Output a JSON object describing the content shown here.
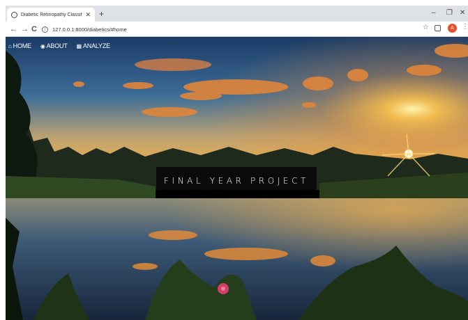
{
  "browser": {
    "tab_title": "Diabetic Retinopathy Classifier",
    "tab_close": "✕",
    "new_tab": "+",
    "url": "127.0.0.1:8000/diabetics/#home",
    "back": "←",
    "forward": "→",
    "reload": "C",
    "bookmark_icon": "☆",
    "profile_initial": "A",
    "menu": "⋮",
    "minimize": "–",
    "restore": "❐",
    "close": "✕"
  },
  "nav": {
    "items": [
      {
        "icon": "home-icon",
        "glyph": "⌂",
        "label": "HOME"
      },
      {
        "icon": "eye-icon",
        "glyph": "◉",
        "label": "ABOUT"
      },
      {
        "icon": "table-icon",
        "glyph": "▦",
        "label": "ANALYZE"
      }
    ]
  },
  "hero": {
    "banner_text": "FINAL YEAR PROJECT",
    "image": "sunset-lake-photo"
  },
  "colors": {
    "tab_strip": "#dee1e6",
    "avatar": "#e8502e",
    "banner_bg": "#000000"
  }
}
